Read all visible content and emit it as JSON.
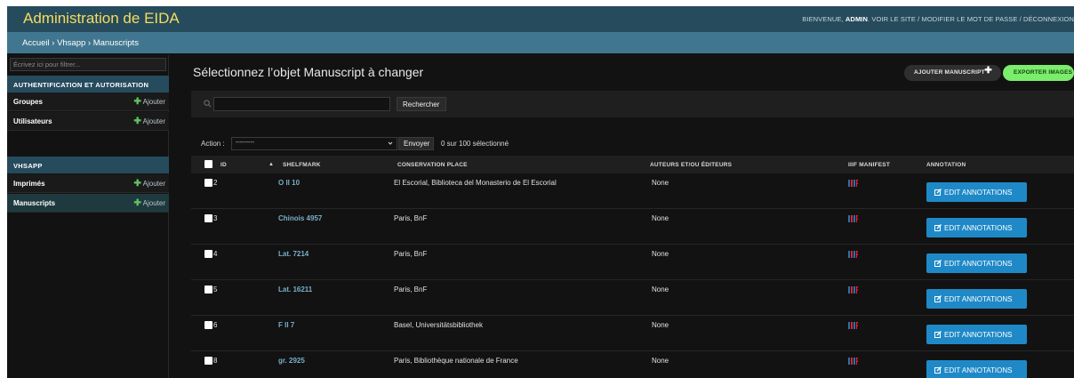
{
  "header": {
    "branding": "Administration de EIDA",
    "welcome": "BIENVENUE,",
    "user": "ADMIN",
    "view_site": "VOIR LE SITE",
    "sep1": " / ",
    "change_password": "MODIFIER LE MOT DE PASSE",
    "sep2": " / ",
    "logout": "DÉCONNEXION"
  },
  "breadcrumbs": "Accueil › Vhsapp › Manuscripts",
  "sidebar": {
    "filter_placeholder": "Écrivez ici pour filtrer...",
    "auth_caption": "AUTHENTIFICATION ET AUTORISATION",
    "auth_models": [
      {
        "name": "Groupes",
        "add": "Ajouter"
      },
      {
        "name": "Utilisateurs",
        "add": "Ajouter"
      }
    ],
    "vhsapp_caption": "VHSAPP",
    "vhsapp_models": [
      {
        "name": "Imprimés",
        "add": "Ajouter"
      },
      {
        "name": "Manuscripts",
        "add": "Ajouter"
      }
    ]
  },
  "content": {
    "title": "Sélectionnez l’objet Manuscript à changer",
    "add_button": "AJOUTER MANUSCRIPT",
    "export_button": "EXPORTER IMAGES",
    "search_button": "Rechercher",
    "action_label": "Action :",
    "action_selected": "---------",
    "go_button": "Envoyer",
    "action_counter": "0 sur 100 sélectionné"
  },
  "table": {
    "headers": {
      "id": "ID",
      "shelfmark": "SHELFMARK",
      "place": "CONSERVATION PLACE",
      "authors": "AUTEURS ET/OU ÉDITEURS",
      "iiif": "IIIF MANIFEST",
      "annotation": "ANNOTATION"
    },
    "edit_label": "EDIT ANNOTATIONS",
    "rows": [
      {
        "id": "2",
        "shelfmark": "O II 10",
        "place": "El Escorial, Biblioteca del Monasterio de El Escorial",
        "authors": "None"
      },
      {
        "id": "3",
        "shelfmark": "Chinois 4957",
        "place": "Paris, BnF",
        "authors": "None"
      },
      {
        "id": "4",
        "shelfmark": "Lat. 7214",
        "place": "Paris, BnF",
        "authors": "None"
      },
      {
        "id": "5",
        "shelfmark": "Lat. 16211",
        "place": "Paris, BnF",
        "authors": "None"
      },
      {
        "id": "6",
        "shelfmark": "F II 7",
        "place": "Basel, Universitätsbibliothek",
        "authors": "None"
      },
      {
        "id": "8",
        "shelfmark": "gr. 2925",
        "place": "Paris, Bibliothèque nationale de France",
        "authors": "None"
      }
    ]
  },
  "colors": {
    "header_bg": "#264b5d",
    "breadcrumb_bg": "#417690",
    "branding": "#f5dd5d",
    "link": "#79aec8",
    "edit_button": "#1f89c7",
    "export_button": "#7aed6c"
  }
}
